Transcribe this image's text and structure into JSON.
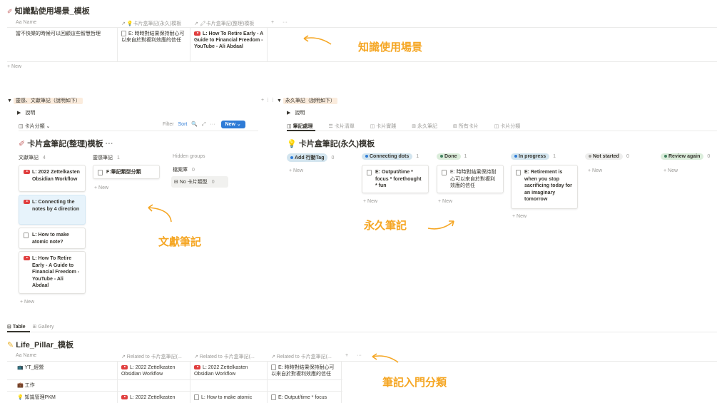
{
  "top": {
    "title": "知識點使用場景_模板",
    "columns": [
      "Aa Name",
      "↗ 💡卡片盒筆記(永久)模板",
      "↗ 🖍卡片盒筆記(整理)模板",
      "+",
      "···"
    ],
    "row": {
      "name": "當不快樂的時候可以回顧這些智慧哲理",
      "rel1": "E: 時時對結果保持耐心可以來自於對複利效應的信任",
      "rel2": "L: How To Retire Early - A Guide to Financial Freedom - YouTube - Ali Abdaal"
    },
    "new_label": "+ New",
    "annotation": "知識使用場景"
  },
  "left": {
    "section": "靈感、文獻筆記（說明如下）",
    "explain": "說明",
    "view_label": "卡片分類",
    "toolbar": {
      "filter": "Filter",
      "sort": "Sort",
      "search": "🔍",
      "expand": "⤢",
      "more": "···",
      "new": "New"
    },
    "board_title": "卡片盒筆記(整理)模板",
    "board_more": "···",
    "groups": [
      {
        "name": "文獻筆記",
        "count": "4"
      },
      {
        "name": "靈感筆記",
        "count": "1"
      }
    ],
    "hidden_groups_label": "Hidden groups",
    "hidden_item": {
      "name": "檔案庫",
      "count": "0"
    },
    "no_type": {
      "name": "No 卡片類型",
      "count": "0"
    },
    "lit_cards": [
      "L: 2022 Zettelkasten Obsidian Workflow",
      "L: Connecting the notes by 4 direction",
      "L: How to make atomic note?",
      "L: How To Retire Early - A Guide to Financial Freedom - YouTube - Ali Abdaal"
    ],
    "insp_card": "F:筆記類型分類",
    "new_label": "+ New",
    "annotation": "文獻筆記"
  },
  "right": {
    "section": "永久筆記（說明如下）",
    "explain": "說明",
    "tabs": [
      "筆記處理",
      "卡片清單",
      "卡片實踐",
      "永久筆記",
      "所有卡片",
      "卡片分類"
    ],
    "board_title": "卡片盒筆記(永久)模板",
    "groups": [
      {
        "name": "Add 行動Tag",
        "count": "0",
        "color": "#d3e5ef",
        "dot": "#2e7bd6"
      },
      {
        "name": "Connecting dots",
        "count": "1",
        "color": "#d3e5ef",
        "dot": "#2e7bd6"
      },
      {
        "name": "Done",
        "count": "1",
        "color": "#dbeddb",
        "dot": "#448361"
      },
      {
        "name": "In progress",
        "count": "1",
        "color": "#d3e5ef",
        "dot": "#2e7bd6"
      },
      {
        "name": "Not started",
        "count": "0",
        "color": "#eeeeed",
        "dot": "#9b9a97"
      },
      {
        "name": "Review again",
        "count": "0",
        "color": "#dbeddb",
        "dot": "#448361"
      }
    ],
    "cards": [
      "E: Output/time * focus * forethought * fun",
      "E: 時時對結果保持耐心可以來自於對複利效應的信任",
      "E: Retirement is when you stop sacrificing today for an imaginary tomorrow"
    ],
    "new_label": "+ New",
    "annotation": "永久筆記"
  },
  "bottom": {
    "tabs": [
      "Table",
      "Gallery"
    ],
    "title": "Life_Pillar_模板",
    "columns": [
      "Aa Name",
      "↗ Related to 卡片盒筆記(...",
      "↗ Related to 卡片盒筆記(...",
      "↗ Related to 卡片盒筆記(...",
      "+",
      "···"
    ],
    "rows": [
      {
        "name": "YT_經營",
        "c1": "L: 2022 Zettelkasten Obsidian Workflow",
        "c2": "L: 2022 Zettelkasten Obsidian Workflow",
        "c3": "E: 時時對結果保持耐心可以來自於對複利效應的信任"
      },
      {
        "name": "工作",
        "c1": "",
        "c2": "",
        "c3": ""
      },
      {
        "name": "知識管理PKM",
        "c1": "L: 2022 Zettelkasten",
        "c2": "L: How to make atomic",
        "c3": "E: Output/time * focus"
      }
    ],
    "annotation": "筆記入門分類"
  }
}
